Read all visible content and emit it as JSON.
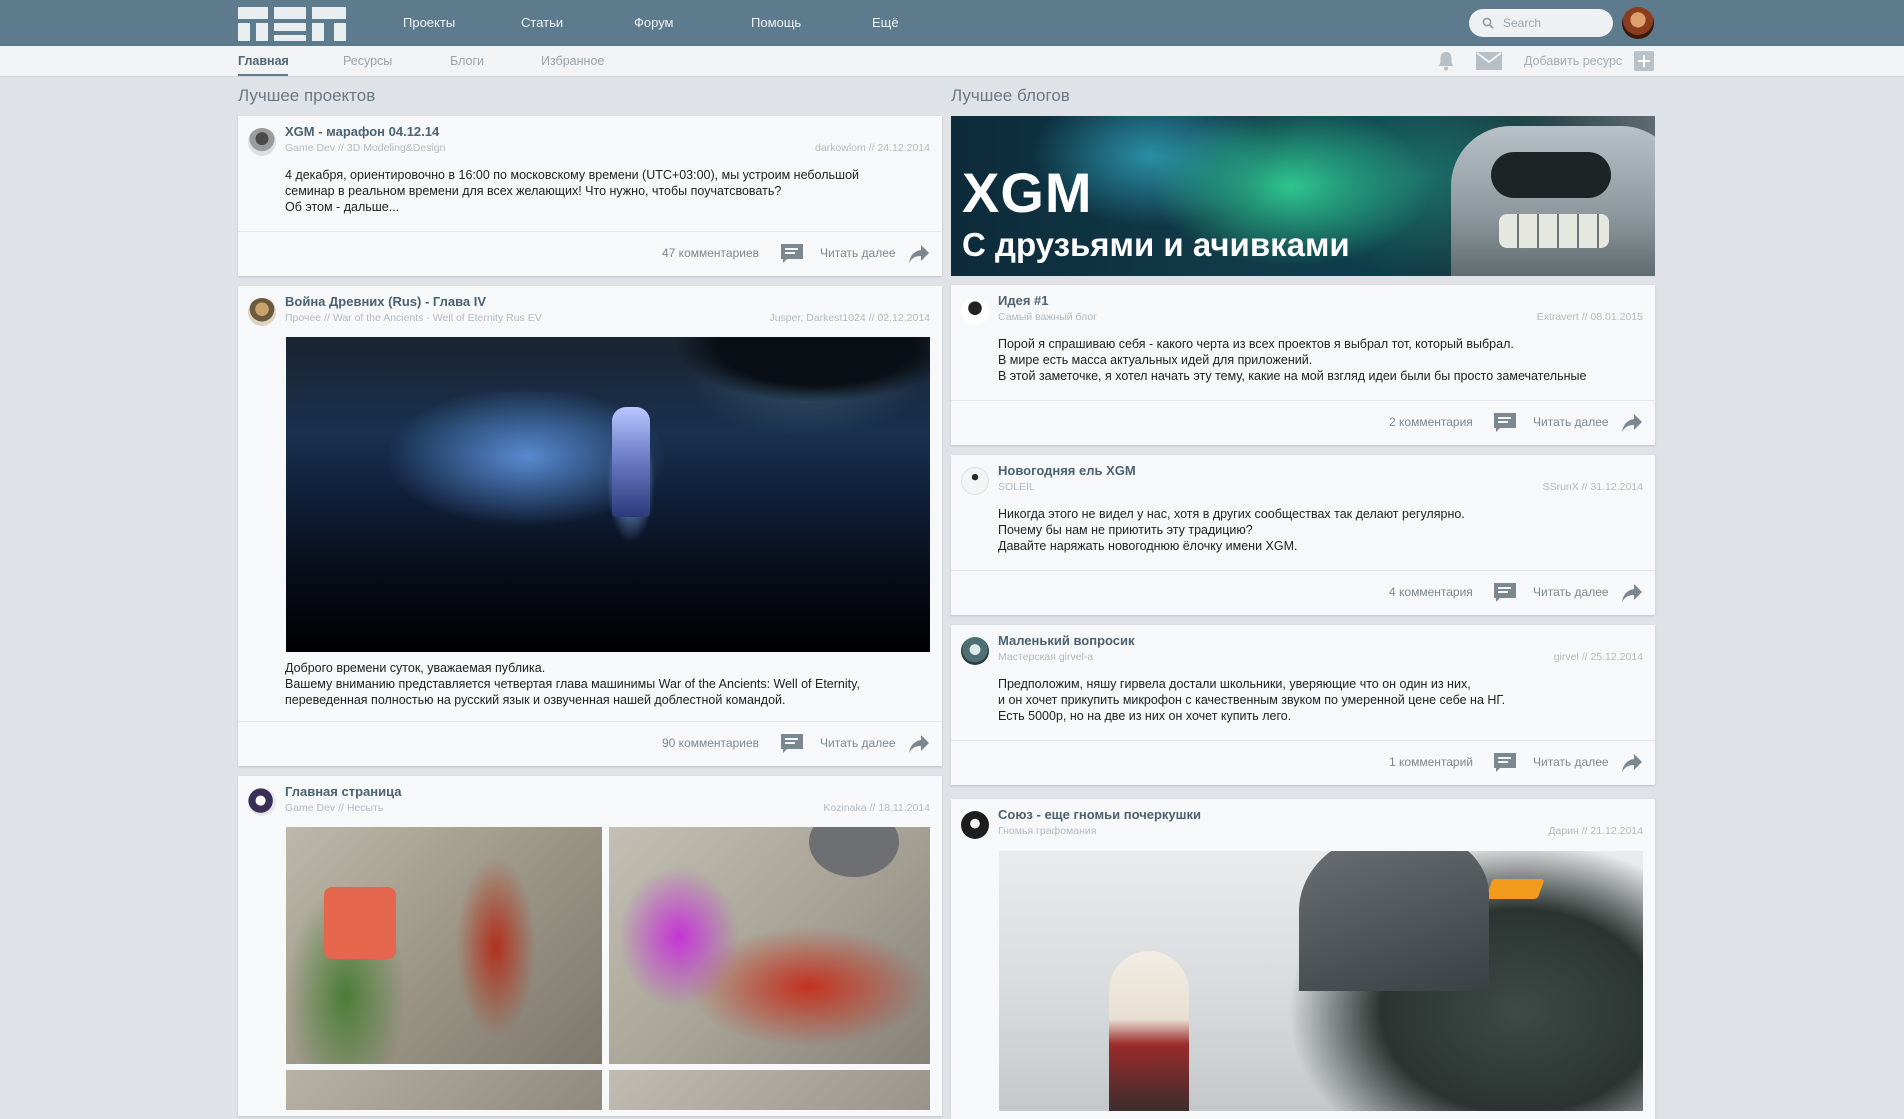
{
  "nav": {
    "items": [
      "Проекты",
      "Статьи",
      "Форум",
      "Помощь",
      "Ещё"
    ],
    "search_placeholder": "Search"
  },
  "subnav": {
    "items": [
      "Главная",
      "Ресурсы",
      "Блоги",
      "Избранное"
    ],
    "active": "Главная",
    "add_resource": "Добавить ресурс"
  },
  "sections": {
    "projects_title": "Лучшее проектов",
    "blogs_title": "Лучшее блогов"
  },
  "banner": {
    "title": "XGM",
    "subtitle": "С друзьями и ачивками"
  },
  "read_more": "Читать далее",
  "projects": [
    {
      "title": "XGM - марафон 04.12.14",
      "category": "Game Dev // 3D Modeling&Design",
      "meta": "darkowlom // 24.12.2014",
      "text": [
        "4 декабря, ориентировочно в 16:00 по московскому времени (UTC+03:00), мы устроим небольшой",
        "семинар в реальном времени для всех желающих! Что нужно, чтобы поучатсвовать?",
        "Об этом - дальше..."
      ],
      "comments": "47 комментариев"
    },
    {
      "title": "Война Древних (Rus) - Глава IV",
      "category": "Прочее // War of the Ancients - Well of Eternity Rus EV",
      "meta": "Jusper, Darkest1024 // 02.12.2014",
      "text": [
        "Доброго времени суток, уважаемая публика.",
        "Вашему вниманию представляется четвертая глава машинимы War of the Ancients: Well of Eternity,",
        "переведенная полностью на русский язык и озвученная нашей доблестной командой."
      ],
      "comments": "90 комментариев"
    },
    {
      "title": "Главная страница",
      "category": "Game Dev // Несыть",
      "meta": "Kozinaka // 18.11.2014"
    }
  ],
  "blogs": [
    {
      "title": "Идея #1",
      "category": "Самый важный блог",
      "meta": "Extravert // 08.01.2015",
      "text": [
        "Порой я спрашиваю себя - какого черта из всех проектов я выбрал тот, который выбрал.",
        "В мире есть масса актуальных идей для приложений.",
        "В этой заметочке, я хотел начать эту тему, какие на мой взгляд идеи были бы просто замечательные"
      ],
      "comments": "2 комментария"
    },
    {
      "title": "Новогодняя ель XGM",
      "category": "SOLEIL",
      "meta": "SSrunX // 31.12.2014",
      "text": [
        "Никогда этого не видел у нас, хотя в других сообществах так делают регулярно.",
        "Почему бы нам не приютить эту традицию?",
        "Давайте наряжать новогоднюю ёлочку имени XGM."
      ],
      "comments": "4 комментария"
    },
    {
      "title": "Маленький вопросик",
      "category": "Мастерская girvel-a",
      "meta": "girvel // 25.12.2014",
      "text": [
        "Предположим, няшу гирвела достали школьники, уверяющие что он один из них,",
        "и он хочет прикупить микрофон с качественным звуком по умеренной цене себе на НГ.",
        "Есть 5000р, но на две из них он хочет купить лего."
      ],
      "comments": "1 комментарий"
    },
    {
      "title": "Союз - еще гномьи почеркушки",
      "category": "Гномья графомания",
      "meta": "Дарин // 21.12.2014"
    }
  ]
}
